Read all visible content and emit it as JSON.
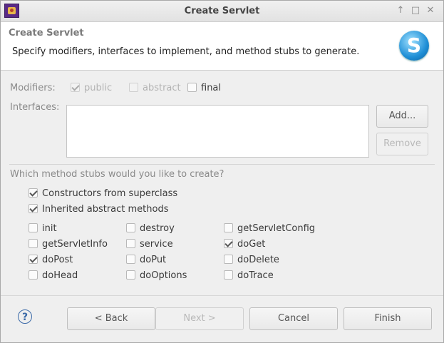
{
  "window": {
    "title": "Create Servlet",
    "controls": {
      "pin": "↑",
      "maximize": "□",
      "close": "✕"
    }
  },
  "banner": {
    "title": "Create Servlet",
    "description": "Specify modifiers, interfaces to implement, and method stubs to generate.",
    "logo_letter": "S"
  },
  "modifiers": {
    "label": "Modifiers:",
    "public": {
      "label": "public",
      "checked": true,
      "enabled": false
    },
    "abstract": {
      "label": "abstract",
      "checked": false,
      "enabled": false
    },
    "final": {
      "label": "final",
      "checked": false,
      "enabled": true
    }
  },
  "interfaces": {
    "label": "Interfaces:",
    "items": [],
    "add_label": "Add...",
    "remove_label": "Remove"
  },
  "stubs": {
    "question": "Which method stubs would you like to create?",
    "constructors": {
      "label": "Constructors from superclass",
      "checked": true
    },
    "inherited": {
      "label": "Inherited abstract methods",
      "checked": true
    },
    "methods": [
      {
        "label": "init",
        "checked": false
      },
      {
        "label": "destroy",
        "checked": false
      },
      {
        "label": "getServletConfig",
        "checked": false
      },
      {
        "label": "getServletInfo",
        "checked": false
      },
      {
        "label": "service",
        "checked": false
      },
      {
        "label": "doGet",
        "checked": true
      },
      {
        "label": "doPost",
        "checked": true
      },
      {
        "label": "doPut",
        "checked": false
      },
      {
        "label": "doDelete",
        "checked": false
      },
      {
        "label": "doHead",
        "checked": false
      },
      {
        "label": "doOptions",
        "checked": false
      },
      {
        "label": "doTrace",
        "checked": false
      }
    ]
  },
  "footer": {
    "help_symbol": "?",
    "back_label": "< Back",
    "next_label": "Next >",
    "cancel_label": "Cancel",
    "finish_label": "Finish"
  },
  "colors": {
    "accent": "#3b6aa8",
    "logo": "#1f8fd6"
  }
}
